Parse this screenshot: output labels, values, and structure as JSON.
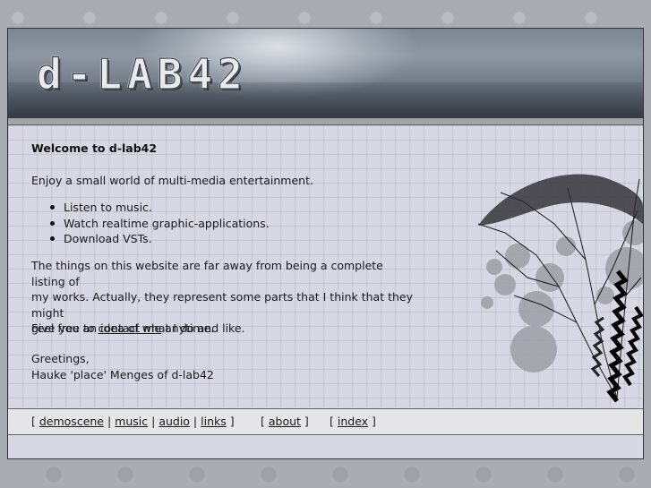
{
  "banner": {
    "logo_text": "d-LAB42"
  },
  "main": {
    "heading": "Welcome to d-lab42",
    "intro": "Enjoy a small world of multi-media entertainment.",
    "list_items": [
      "Listen to music.",
      "Watch realtime graphic-applications.",
      "Download VSTs."
    ],
    "things_line1": "The things on this website are far away from being a complete listing of",
    "things_line2": "my works. Actually, they represent some parts that I think that they might",
    "things_line3": "give you an idea of what I do and like.",
    "feel_prefix": "Feel free to ",
    "contact_link": "contact me",
    "feel_suffix": " anytime.",
    "greetings": "Greetings,",
    "signature": "Hauke 'place' Menges of d-lab42"
  },
  "footer": {
    "bracket_open": "[ ",
    "bracket_close": " ]",
    "separator": " | ",
    "links": [
      "demoscene",
      "music",
      "audio",
      "links"
    ],
    "about": "about",
    "index": "index"
  },
  "colors": {
    "page_bg": "#a9adb3",
    "content_bg": "#d8d8e4",
    "footer_bg": "#e6e6e8",
    "border": "#2f3338"
  }
}
